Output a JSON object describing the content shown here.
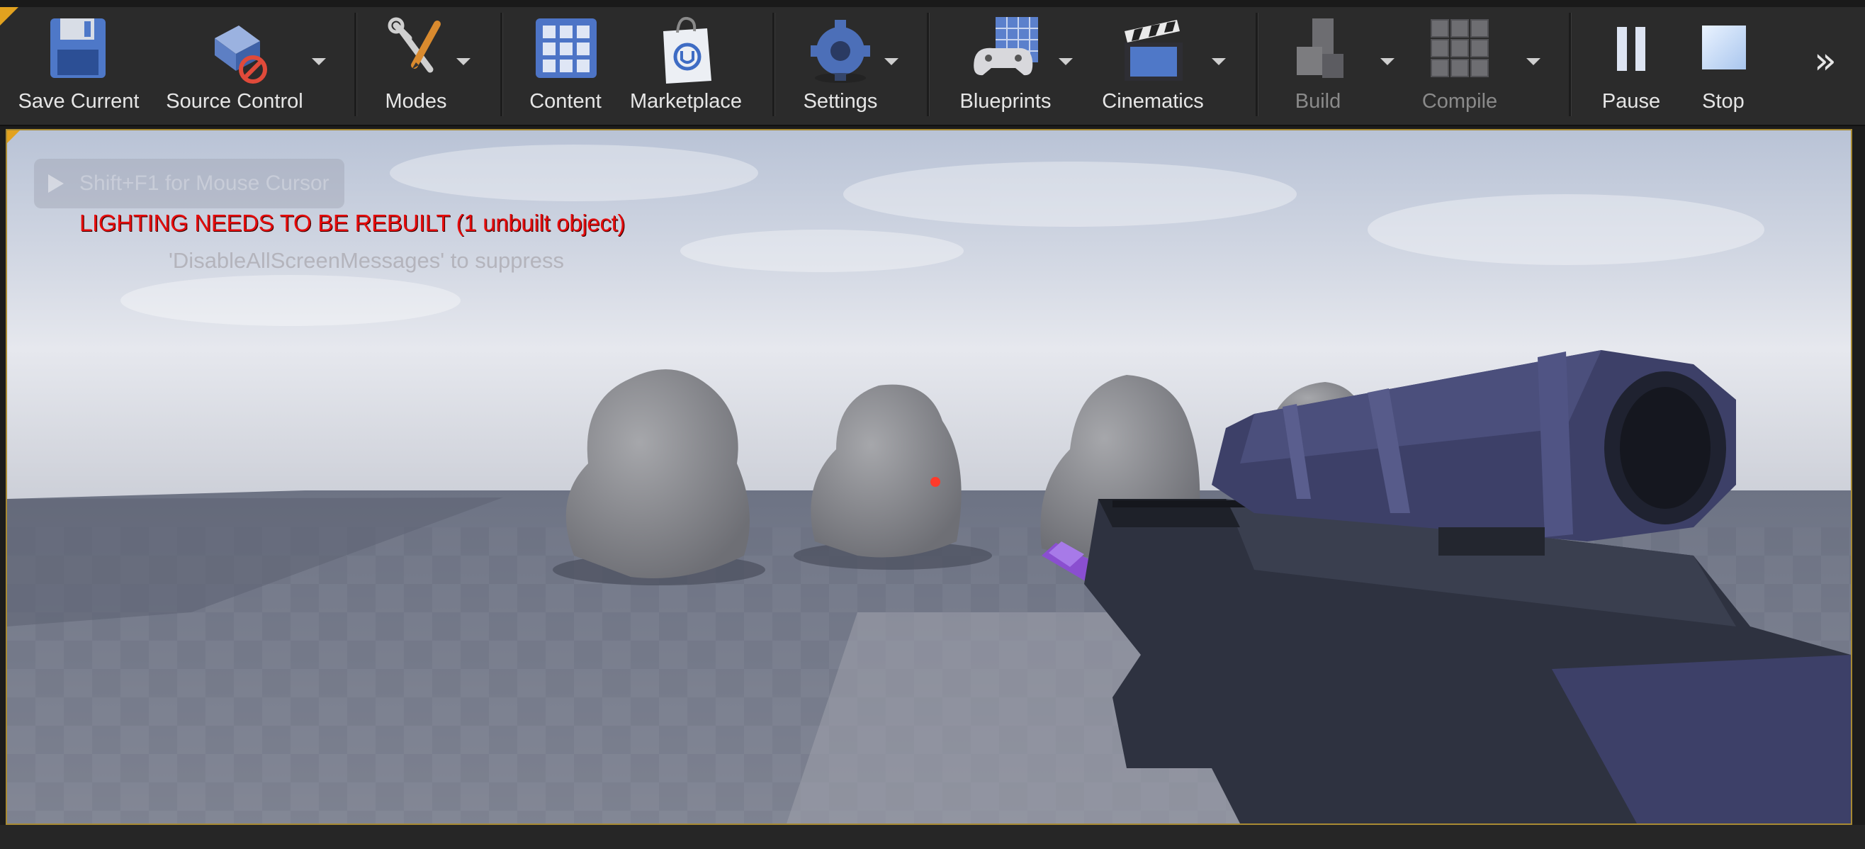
{
  "toolbar": {
    "items": [
      {
        "label": "Save Current",
        "icon": "floppy-disk-icon",
        "dropdown": false,
        "disabled": false
      },
      {
        "label": "Source Control",
        "icon": "source-control-icon",
        "dropdown": true,
        "disabled": false
      },
      {
        "label": "Modes",
        "icon": "modes-tools-icon",
        "dropdown": true,
        "disabled": false
      },
      {
        "label": "Content",
        "icon": "content-grid-icon",
        "dropdown": false,
        "disabled": false
      },
      {
        "label": "Marketplace",
        "icon": "marketplace-bag-icon",
        "dropdown": false,
        "disabled": false
      },
      {
        "label": "Settings",
        "icon": "settings-gear-icon",
        "dropdown": true,
        "disabled": false
      },
      {
        "label": "Blueprints",
        "icon": "blueprints-gamepad-icon",
        "dropdown": true,
        "disabled": false
      },
      {
        "label": "Cinematics",
        "icon": "clapperboard-icon",
        "dropdown": true,
        "disabled": false
      },
      {
        "label": "Build",
        "icon": "build-blocks-icon",
        "dropdown": true,
        "disabled": true
      },
      {
        "label": "Compile",
        "icon": "compile-cubes-icon",
        "dropdown": true,
        "disabled": true
      },
      {
        "label": "Pause",
        "icon": "pause-icon",
        "dropdown": false,
        "disabled": false
      },
      {
        "label": "Stop",
        "icon": "stop-icon",
        "dropdown": false,
        "disabled": false
      }
    ],
    "overflow_glyph": "»"
  },
  "viewport": {
    "hint": "Shift+F1 for Mouse Cursor",
    "warning": "LIGHTING NEEDS TO BE REBUILT (1 unbuilt object)",
    "suppress_hint": "'DisableAllScreenMessages' to suppress"
  },
  "colors": {
    "toolbar_bg": "#2b2b2b",
    "accent": "#e2a21f",
    "warning_red": "#e60c0c",
    "rifle_body": "#2e3240",
    "scope": "#3d4068",
    "barrel_purple": "#8a4fd0"
  }
}
